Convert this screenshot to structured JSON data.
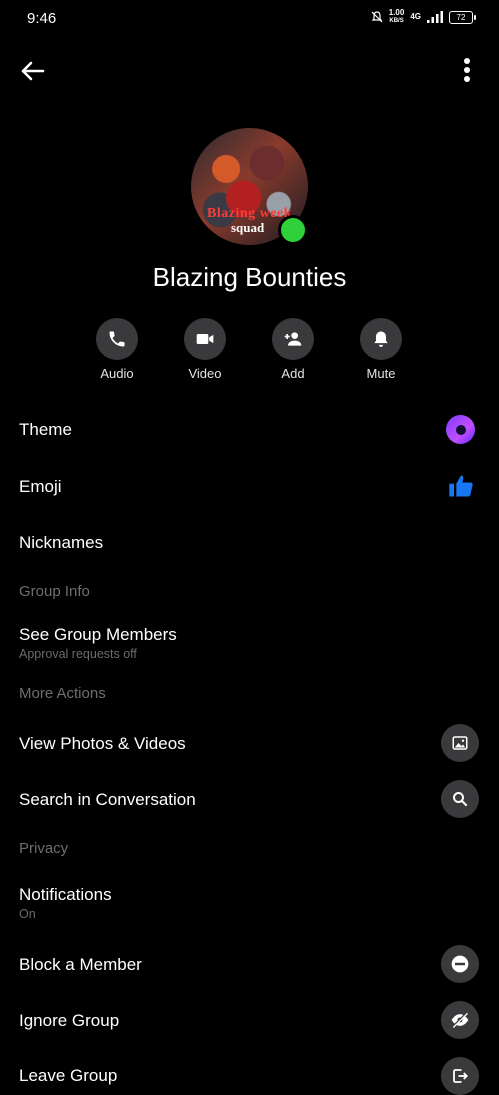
{
  "status_bar": {
    "time": "9:46",
    "speed_value": "1.00",
    "speed_unit": "KB/S",
    "network": "4G",
    "battery": "72"
  },
  "profile": {
    "name": "Blazing Bounties",
    "avatar_text_line1": "Blazing week",
    "avatar_text_line2": "squad",
    "online_color": "#2fd13a"
  },
  "actions": [
    {
      "label": "Audio",
      "icon": "phone-icon"
    },
    {
      "label": "Video",
      "icon": "video-camera-icon"
    },
    {
      "label": "Add",
      "icon": "add-person-icon"
    },
    {
      "label": "Mute",
      "icon": "bell-icon"
    }
  ],
  "settings": {
    "theme": "Theme",
    "emoji": "Emoji",
    "nicknames": "Nicknames",
    "section_group_info": "Group Info",
    "see_members": "See Group Members",
    "see_members_sub": "Approval requests off",
    "section_more_actions": "More Actions",
    "view_media": "View Photos & Videos",
    "search": "Search in Conversation",
    "section_privacy": "Privacy",
    "notifications": "Notifications",
    "notifications_sub": "On",
    "block": "Block a Member",
    "ignore": "Ignore Group",
    "leave": "Leave Group"
  },
  "colors": {
    "background": "#000000",
    "icon_bg": "#3a3a3c",
    "section_text": "#6e6e6e",
    "like_blue": "#1877f2"
  }
}
